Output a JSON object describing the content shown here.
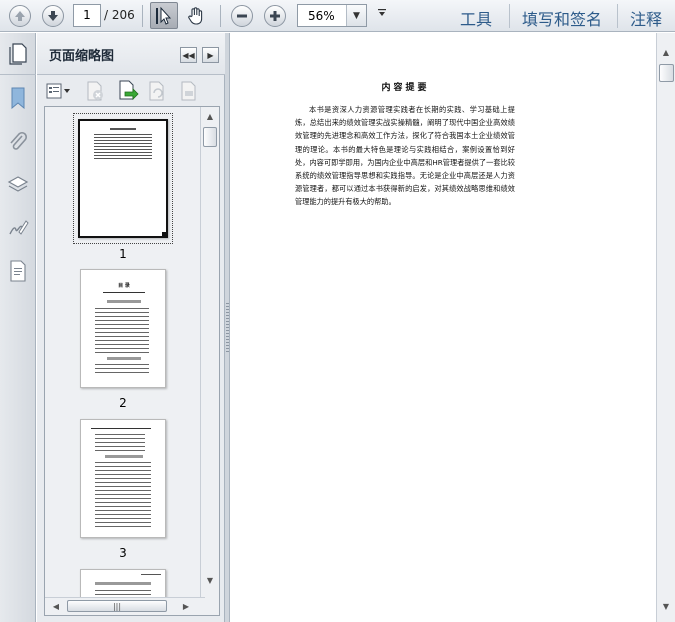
{
  "toolbar": {
    "current_page": "1",
    "total_pages": "/ 206",
    "zoom": "56%",
    "links": {
      "tools": "工具",
      "sign": "填写和签名",
      "comment": "注释"
    }
  },
  "panel": {
    "title": "页面缩略图",
    "thumbnails": [
      {
        "label": "1"
      },
      {
        "label": "2"
      },
      {
        "label": "3"
      }
    ]
  },
  "thumb2": {
    "heading": "目 录"
  },
  "document": {
    "title": "内容提要",
    "body": "本书是资深人力资源管理实践者在长期的实践、学习基础上提炼，总结出来的绩效管理实战实操精髓，阐明了现代中国企业高效绩效管理的先进理念和高效工作方法，探化了符合我国本土企业绩效管理的理论。本书的最大特色是理论与实践相结合，案例设置恰到好处，内容可即学即用，为国内企业中高层和HR管理者提供了一套比较系统的绩效管理指导思想和实践指导。无论是企业中高层还是人力资源管理者，都可以通过本书获得新的启发，对其绩效战略思维和绩效管理能力的提升有极大的帮助。"
  },
  "icons": [
    "up-arrow-icon",
    "down-arrow-icon",
    "select-cursor-icon",
    "hand-icon",
    "zoom-out-icon",
    "zoom-in-icon",
    "bookmark-icon",
    "paperclip-icon",
    "layers-icon",
    "signature-icon",
    "page-icon"
  ]
}
